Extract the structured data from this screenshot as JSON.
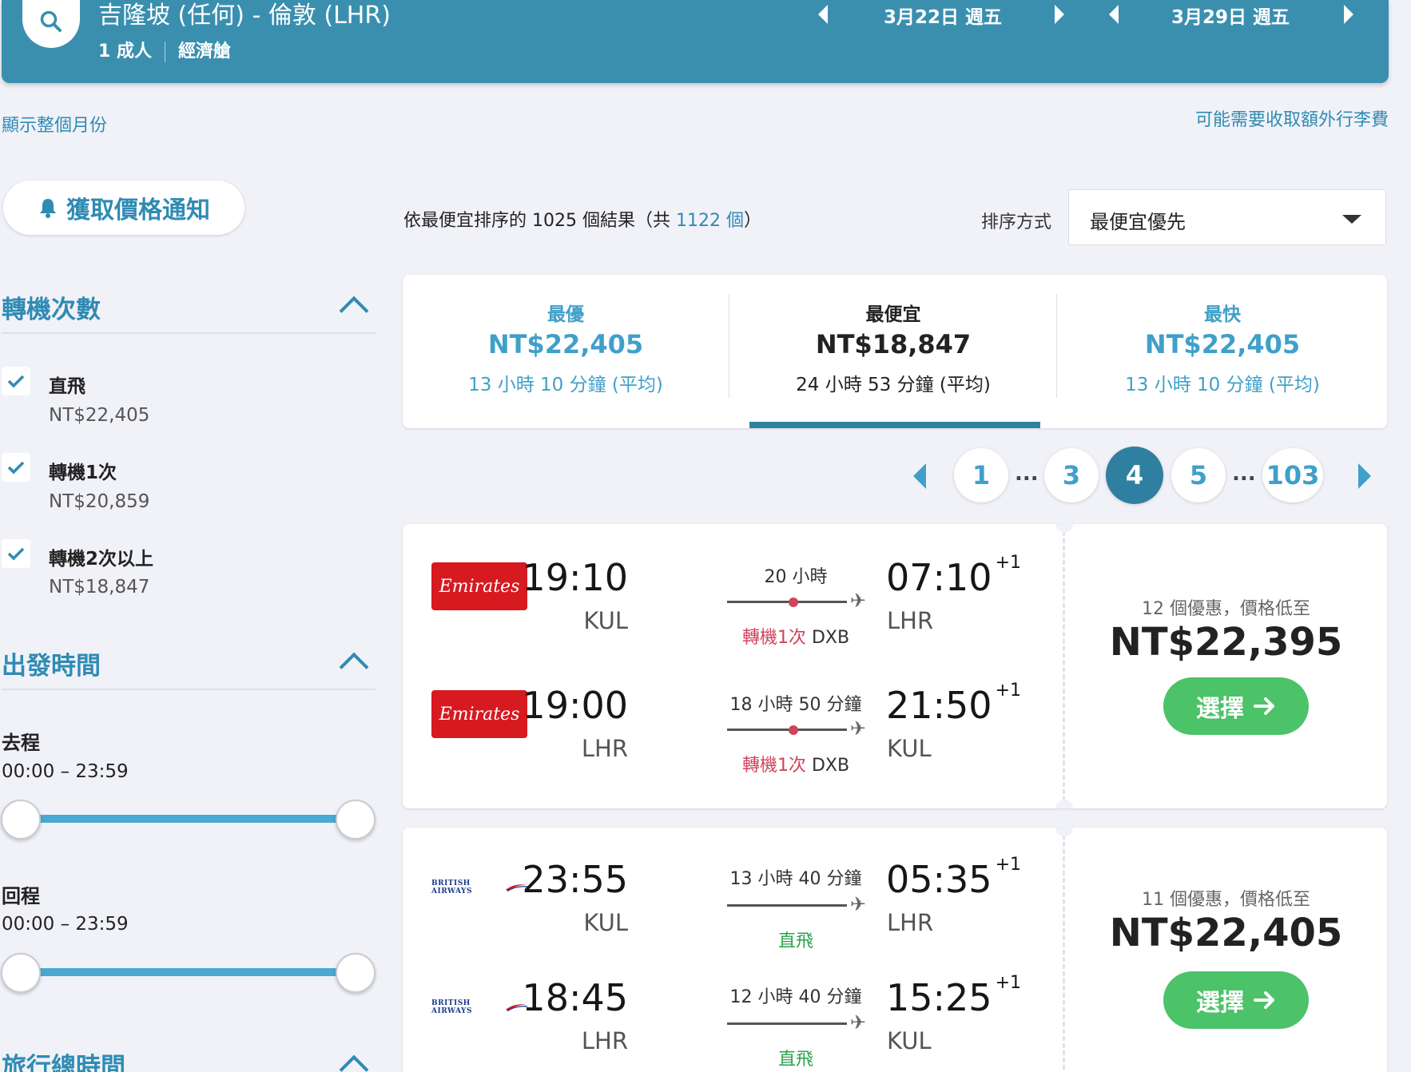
{
  "header": {
    "route": "吉隆坡 (任何) - 倫敦 (LHR)",
    "passengers": "1 成人",
    "cabin": "經濟艙",
    "depart_date": "3月22日 週五",
    "return_date": "3月29日 週五"
  },
  "links": {
    "show_month": "顯示整個月份",
    "baggage": "可能需要收取額外行李費"
  },
  "price_alert": {
    "label": "獲取價格通知"
  },
  "results": {
    "count_prefix": "依最便宜排序的 1025 個結果（共 ",
    "total": "1122 個",
    "count_suffix": "）",
    "sort_label": "排序方式",
    "sort_value": "最便宜優先"
  },
  "sidebar": {
    "stops_title": "轉機次數",
    "stops": [
      {
        "label": "直飛",
        "price": "NT$22,405",
        "checked": true
      },
      {
        "label": "轉機1次",
        "price": "NT$20,859",
        "checked": true
      },
      {
        "label": "轉機2次以上",
        "price": "NT$18,847",
        "checked": true
      }
    ],
    "time_title": "出發時間",
    "outbound_label": "去程",
    "outbound_range": "00:00 – 23:59",
    "return_label": "回程",
    "return_range": "00:00 – 23:59",
    "duration_title": "旅行總時間"
  },
  "tabs": [
    {
      "label": "最優",
      "price": "NT$22,405",
      "duration": "13 小時 10 分鐘 (平均)",
      "active": false
    },
    {
      "label": "最便宜",
      "price": "NT$18,847",
      "duration": "24 小時 53 分鐘 (平均)",
      "active": true
    },
    {
      "label": "最快",
      "price": "NT$22,405",
      "duration": "13 小時 10 分鐘 (平均)",
      "active": false
    }
  ],
  "pagination": {
    "pages": [
      "1",
      "3",
      "4",
      "5",
      "103"
    ],
    "current": "4",
    "dots": "..."
  },
  "cards": [
    {
      "airline": "Emirates",
      "legs": [
        {
          "dep_time": "19:10",
          "dep_ap": "KUL",
          "duration": "20 小時",
          "stops_label": "轉機1次",
          "stops_code": "DXB",
          "arr_time": "07:10",
          "arr_offset": "+1",
          "arr_ap": "LHR"
        },
        {
          "dep_time": "19:00",
          "dep_ap": "LHR",
          "duration": "18 小時 50 分鐘",
          "stops_label": "轉機1次",
          "stops_code": "DXB",
          "arr_time": "21:50",
          "arr_offset": "+1",
          "arr_ap": "KUL"
        }
      ],
      "deals": "12 個優惠，價格低至",
      "price": "NT$22,395",
      "select_label": "選擇"
    },
    {
      "airline": "BRITISH AIRWAYS",
      "legs": [
        {
          "dep_time": "23:55",
          "dep_ap": "KUL",
          "duration": "13 小時 40 分鐘",
          "stops_label": "直飛",
          "arr_time": "05:35",
          "arr_offset": "+1",
          "arr_ap": "LHR"
        },
        {
          "dep_time": "18:45",
          "dep_ap": "LHR",
          "duration": "12 小時 40 分鐘",
          "stops_label": "直飛",
          "arr_time": "15:25",
          "arr_offset": "+1",
          "arr_ap": "KUL"
        }
      ],
      "deals": "11 個優惠，價格低至",
      "price": "NT$22,405",
      "select_label": "選擇"
    }
  ],
  "colors": {
    "header": "#3a8fae",
    "accent": "#3fa0c9",
    "select": "#4cc269",
    "stop_red": "#d1435b",
    "direct_green": "#2aa34a",
    "emirates_red": "#d71920"
  }
}
